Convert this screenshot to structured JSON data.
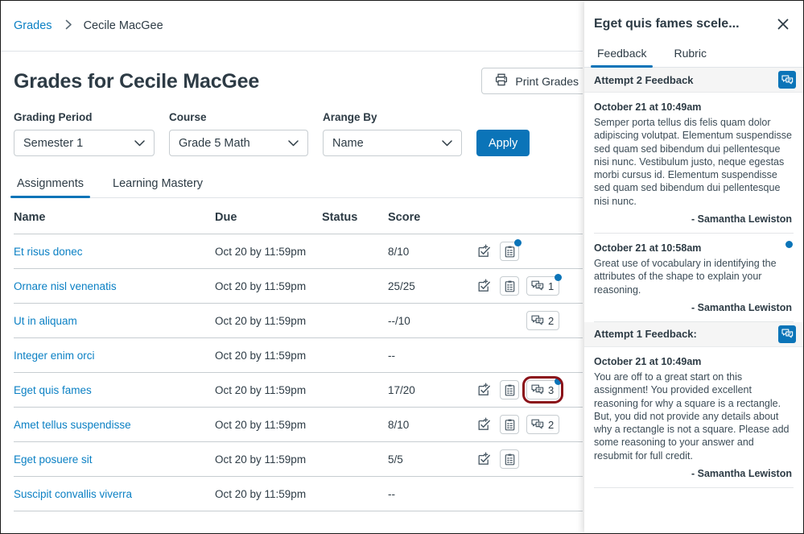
{
  "breadcrumb": {
    "root": "Grades",
    "separator": "›",
    "current": "Cecile MacGee"
  },
  "page": {
    "title": "Grades for Cecile MacGee"
  },
  "toolbar": {
    "print_label": "Print Grades",
    "print_icon": "printer-icon"
  },
  "filters": {
    "grading_period": {
      "label": "Grading Period",
      "value": "Semester 1"
    },
    "course": {
      "label": "Course",
      "value": "Grade 5 Math"
    },
    "arrange_by": {
      "label": "Arange By",
      "value": "Name"
    },
    "apply_label": "Apply"
  },
  "tabs": [
    {
      "label": "Assignments",
      "active": true
    },
    {
      "label": "Learning Mastery",
      "active": false
    }
  ],
  "table": {
    "columns": [
      "Name",
      "Due",
      "Status",
      "Score"
    ],
    "rows": [
      {
        "name": "Et risus donec",
        "due": "Oct 20 by 11:59pm",
        "status": "",
        "score": "8/10",
        "score_details": true,
        "rubric": true,
        "rubric_dot": true,
        "comments": null,
        "comments_dot": false,
        "highlight": false
      },
      {
        "name": "Ornare nisl venenatis",
        "due": "Oct 20 by 11:59pm",
        "status": "",
        "score": "25/25",
        "score_details": true,
        "rubric": true,
        "rubric_dot": false,
        "comments": "1",
        "comments_dot": true,
        "highlight": false
      },
      {
        "name": "Ut in aliquam",
        "due": "Oct 20 by 11:59pm",
        "status": "",
        "score": "--/10",
        "score_details": false,
        "rubric": false,
        "rubric_dot": false,
        "comments": "2",
        "comments_dot": false,
        "highlight": false
      },
      {
        "name": "Integer enim orci",
        "due": "Oct 20 by 11:59pm",
        "status": "",
        "score": "--",
        "score_details": false,
        "rubric": false,
        "rubric_dot": false,
        "comments": null,
        "comments_dot": false,
        "highlight": false
      },
      {
        "name": "Eget quis fames",
        "due": "Oct 20 by 11:59pm",
        "status": "",
        "score": "17/20",
        "score_details": true,
        "rubric": true,
        "rubric_dot": false,
        "comments": "3",
        "comments_dot": true,
        "highlight": true
      },
      {
        "name": "Amet tellus suspendisse",
        "due": "Oct 20 by 11:59pm",
        "status": "",
        "score": "8/10",
        "score_details": true,
        "rubric": true,
        "rubric_dot": false,
        "comments": "2",
        "comments_dot": false,
        "highlight": false
      },
      {
        "name": "Eget posuere sit",
        "due": "Oct 20 by 11:59pm",
        "status": "",
        "score": "5/5",
        "score_details": true,
        "rubric": true,
        "rubric_dot": false,
        "comments": null,
        "comments_dot": false,
        "highlight": false
      },
      {
        "name": "Suscipit convallis viverra",
        "due": "Oct 20 by 11:59pm",
        "status": "",
        "score": "--",
        "score_details": false,
        "rubric": false,
        "rubric_dot": false,
        "comments": null,
        "comments_dot": false,
        "highlight": false
      }
    ]
  },
  "tray": {
    "title": "Eget quis fames scele...",
    "close_icon": "close-icon",
    "tabs": [
      {
        "label": "Feedback",
        "active": true
      },
      {
        "label": "Rubric",
        "active": false
      }
    ],
    "attempts": [
      {
        "header": "Attempt 2 Feedback",
        "header_icon": "comment-icon",
        "comments": [
          {
            "when": "October 21 at 10:49am",
            "body": "Semper porta tellus dis felis quam dolor adipiscing volutpat. Elementum suspendisse sed quam sed bibendum dui pellentesque nisi nunc. Vestibulum justo, neque egestas morbi cursus id. Elementum suspendisse sed quam sed bibendum dui pellentesque nisi nunc.",
            "author": "- Samantha Lewiston",
            "unread": false
          },
          {
            "when": "October 21 at 10:58am",
            "body": "Great use of vocabulary in identifying the attributes of the shape to explain your reasoning.",
            "author": "- Samantha Lewiston",
            "unread": true
          }
        ]
      },
      {
        "header": "Attempt 1 Feedback:",
        "header_icon": "comment-icon",
        "comments": [
          {
            "when": "October 21 at 10:49am",
            "body": "You are off to a great start on this assignment! You provided excellent reasoning for why a square is a rectangle. But, you did not provide any details about why a rectangle is not a square. Please add some reasoning to your answer and resubmit for full credit.",
            "author": "- Samantha Lewiston",
            "unread": false
          }
        ]
      }
    ]
  },
  "colors": {
    "link": "#0b80c4",
    "accent": "#0b74b8",
    "text": "#2D3B45",
    "highlight_ring": "#8b1219",
    "border": "#c7cdd1"
  }
}
